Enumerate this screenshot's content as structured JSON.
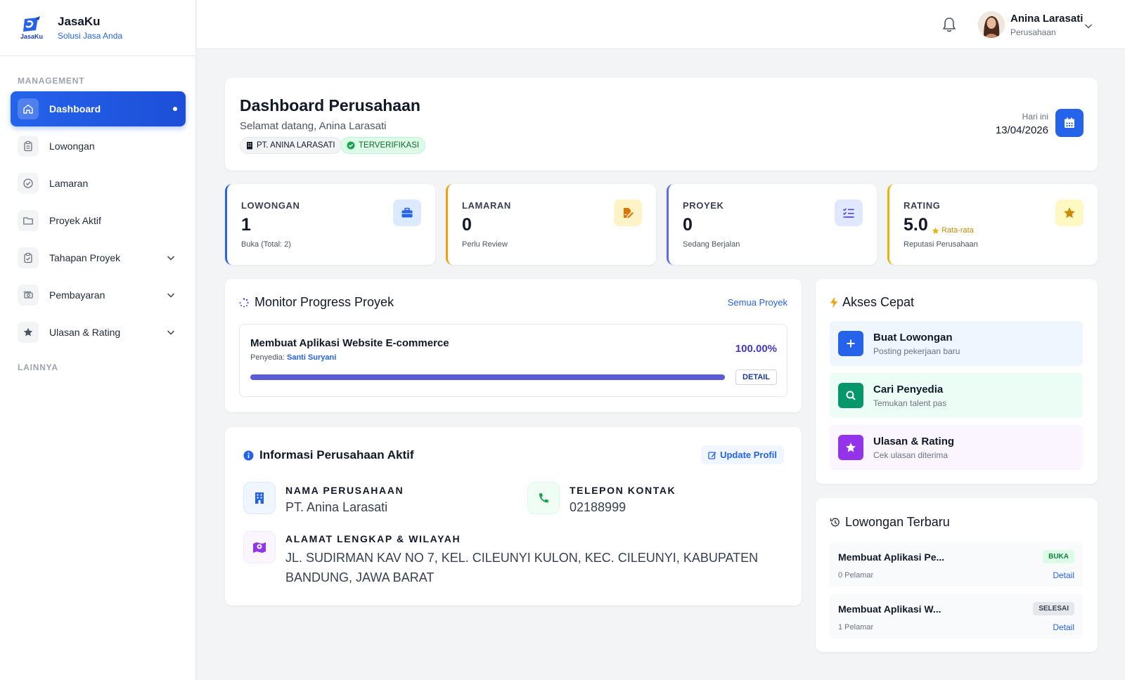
{
  "brand": {
    "logo_text": "JasaKu",
    "name": "JasaKu",
    "tagline": "Solusi Jasa Anda"
  },
  "sidebar": {
    "section_management": "MANAGEMENT",
    "section_other": "LAINNYA",
    "items": [
      {
        "label": "Dashboard",
        "icon": "home-icon",
        "active": true
      },
      {
        "label": "Lowongan",
        "icon": "clipboard-icon"
      },
      {
        "label": "Lamaran",
        "icon": "check-circle-icon"
      },
      {
        "label": "Proyek Aktif",
        "icon": "folder-icon"
      },
      {
        "label": "Tahapan Proyek",
        "icon": "clipboard-check-icon",
        "expandable": true
      },
      {
        "label": "Pembayaran",
        "icon": "money-icon",
        "expandable": true
      },
      {
        "label": "Ulasan & Rating",
        "icon": "star-icon",
        "expandable": true
      }
    ]
  },
  "topbar": {
    "user_name": "Anina Larasati",
    "user_role": "Perusahaan"
  },
  "header": {
    "title": "Dashboard Perusahaan",
    "welcome": "Selamat datang, Anina Larasati",
    "company_badge": "PT. ANINA LARASATI",
    "verified_badge": "TERVERIFIKASI",
    "date_label": "Hari ini",
    "date": "13/04/2026"
  },
  "stats": [
    {
      "title": "LOWONGAN",
      "value": "1",
      "note": "Buka (Total: 2)",
      "color": "#2563eb"
    },
    {
      "title": "LAMARAN",
      "value": "0",
      "note": "Perlu Review",
      "color": "#f59e0b"
    },
    {
      "title": "PROYEK",
      "value": "0",
      "note": "Sedang Berjalan",
      "color": "#6366f1"
    },
    {
      "title": "RATING",
      "value": "5.0",
      "extra": "Rata-rata",
      "note": "Reputasi Perusahaan",
      "color": "#eab308"
    }
  ],
  "monitor": {
    "title": "Monitor Progress Proyek",
    "link": "Semua Proyek",
    "project": {
      "name": "Membuat Aplikasi Website E-commerce",
      "provider_label": "Penyedia:",
      "provider": "Santi Suryani",
      "percent_text": "100.00%",
      "progress": 1.0,
      "detail": "DETAIL"
    }
  },
  "info": {
    "title": "Informasi Perusahaan Aktif",
    "update": "Update Profil",
    "name_label": "NAMA PERUSAHAAN",
    "name": "PT. Anina Larasati",
    "phone_label": "TELEPON KONTAK",
    "phone": "02188999",
    "address_label": "ALAMAT LENGKAP & WILAYAH",
    "address": "JL. SUDIRMAN KAV NO 7, KEL. CILEUNYI KULON, KEC. CILEUNYI, KABUPATEN BANDUNG, JAWA BARAT"
  },
  "quick": {
    "title": "Akses Cepat",
    "items": [
      {
        "title": "Buat Lowongan",
        "desc": "Posting pekerjaan baru"
      },
      {
        "title": "Cari Penyedia",
        "desc": "Temukan talent pas"
      },
      {
        "title": "Ulasan & Rating",
        "desc": "Cek ulasan diterima"
      }
    ]
  },
  "latest": {
    "title": "Lowongan Terbaru",
    "items": [
      {
        "title": "Membuat Aplikasi Pe...",
        "applicants": "0 Pelamar",
        "status": "BUKA",
        "link": "Detail"
      },
      {
        "title": "Membuat Aplikasi W...",
        "applicants": "1 Pelamar",
        "status": "SELESAI",
        "link": "Detail"
      }
    ]
  }
}
